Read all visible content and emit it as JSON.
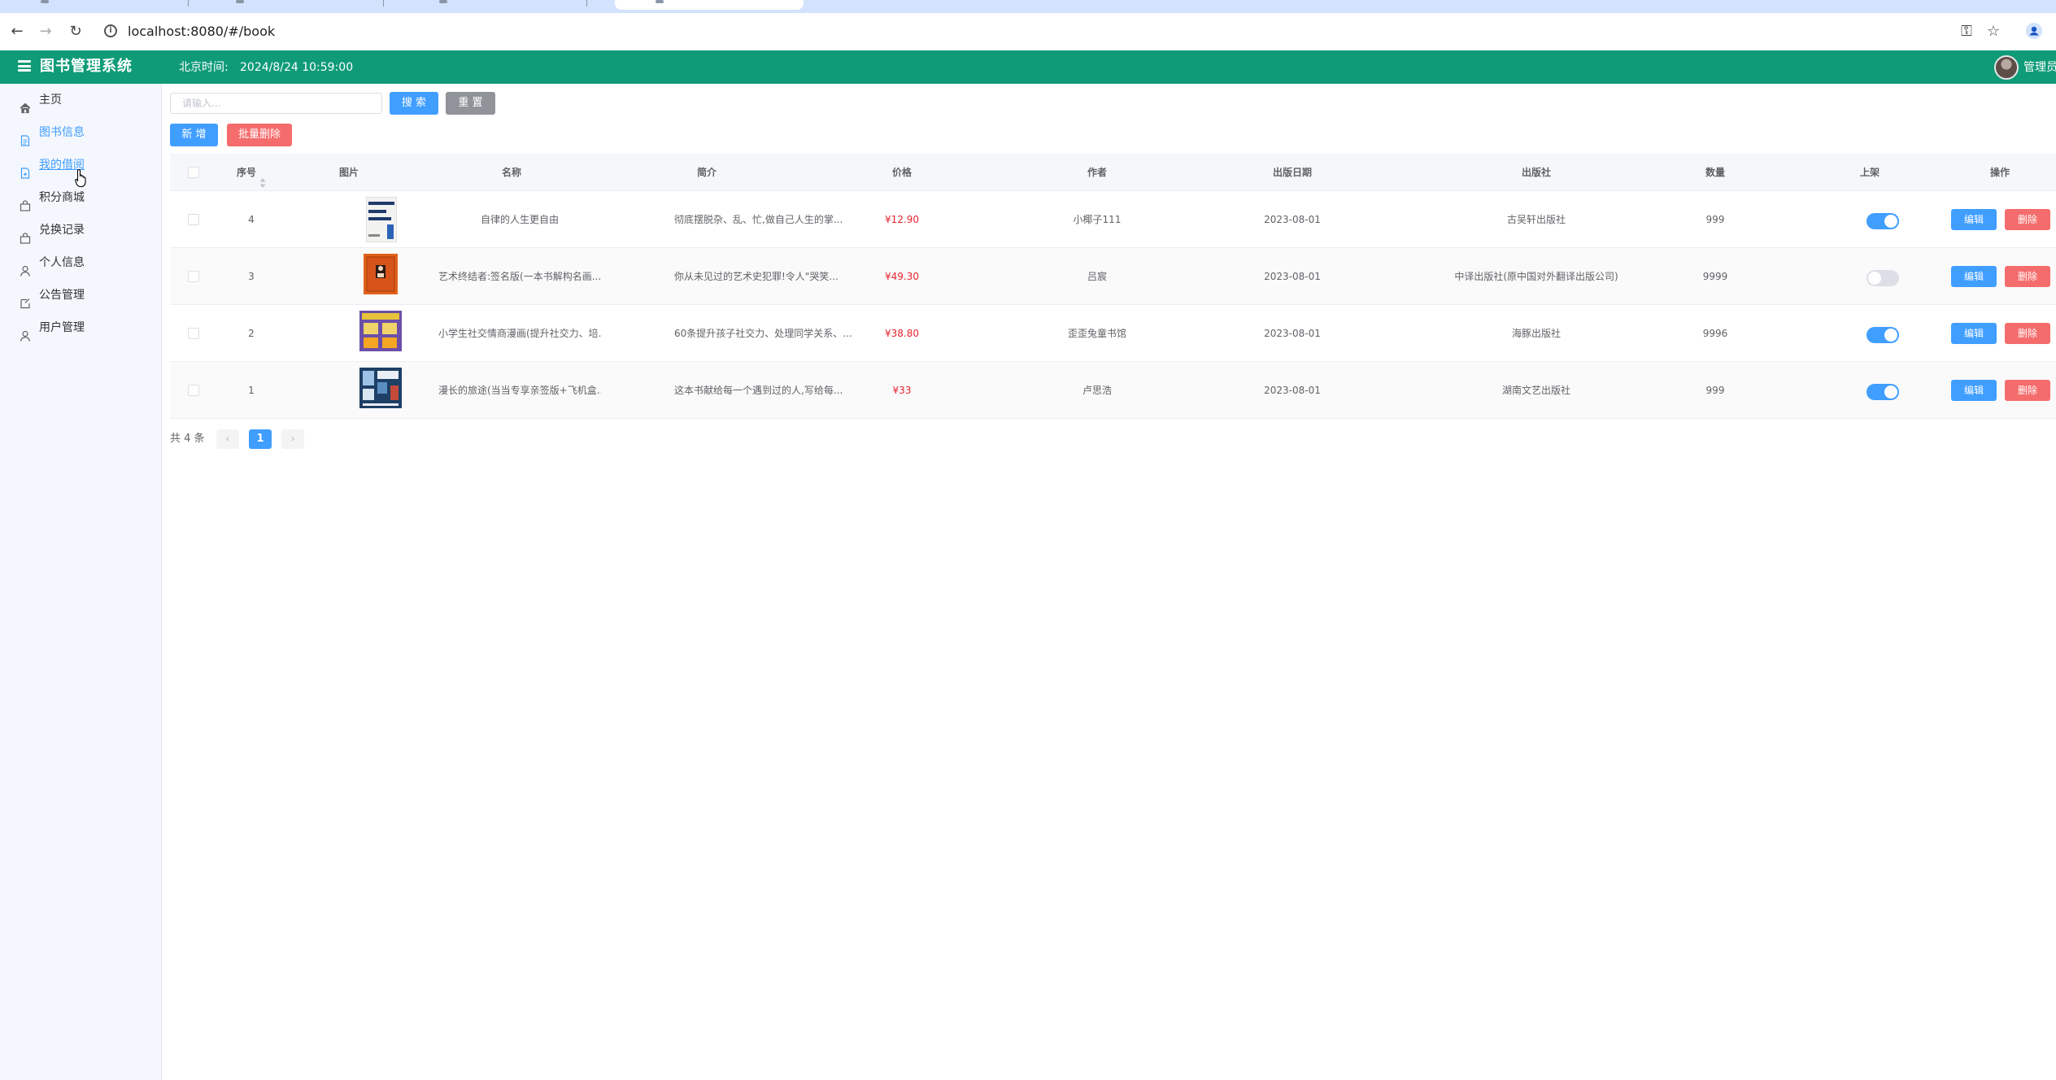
{
  "browser": {
    "url": "localhost:8080/#/book"
  },
  "header": {
    "title": "图书管理系统",
    "clock_label": "北京时间:",
    "clock_value": "2024/8/24 10:59:00",
    "user": "管理员"
  },
  "sidebar": {
    "items": [
      {
        "label": "主页",
        "icon": "home-icon"
      },
      {
        "label": "图书信息",
        "icon": "document-icon"
      },
      {
        "label": "我的借阅",
        "icon": "document-plus-icon"
      },
      {
        "label": "积分商城",
        "icon": "shopping-bag-icon"
      },
      {
        "label": "兑换记录",
        "icon": "shopping-bag-icon"
      },
      {
        "label": "个人信息",
        "icon": "user-icon"
      },
      {
        "label": "公告管理",
        "icon": "notice-icon"
      },
      {
        "label": "用户管理",
        "icon": "user-icon"
      }
    ]
  },
  "search": {
    "placeholder": "请输入...",
    "search_label": "搜 索",
    "reset_label": "重 置"
  },
  "actions": {
    "add_label": "新 增",
    "batch_delete_label": "批量删除"
  },
  "table": {
    "headers": {
      "id": "序号",
      "image": "图片",
      "name": "名称",
      "intro": "简介",
      "price": "价格",
      "author": "作者",
      "date": "出版日期",
      "publisher": "出版社",
      "quantity": "数量",
      "listed": "上架",
      "ops": "操作"
    },
    "edit_label": "编辑",
    "delete_label": "删除",
    "rows": [
      {
        "id": "4",
        "name": "自律的人生更自由",
        "intro": "彻底摆脱杂、乱、忙,做自己人生的掌...",
        "price": "¥12.90",
        "author": "小椰子111",
        "date": "2023-08-01",
        "publisher": "古吴轩出版社",
        "quantity": "999",
        "listed": true
      },
      {
        "id": "3",
        "name": "艺术终结者:签名版(一本书解构名画...",
        "intro": "你从未见过的艺术史犯罪!令人\"哭笑...",
        "price": "¥49.30",
        "author": "吕宸",
        "date": "2023-08-01",
        "publisher": "中译出版社(原中国对外翻译出版公司)",
        "quantity": "9999",
        "listed": false
      },
      {
        "id": "2",
        "name": "小学生社交情商漫画(提升社交力、培...",
        "intro": "60条提升孩子社交力、处理同学关系、...",
        "price": "¥38.80",
        "author": "歪歪兔童书馆",
        "date": "2023-08-01",
        "publisher": "海豚出版社",
        "quantity": "9996",
        "listed": true
      },
      {
        "id": "1",
        "name": "漫长的旅途(当当专享亲签版+飞机盒...",
        "intro": "这本书献给每一个遇到过的人,写给每...",
        "price": "¥33",
        "author": "卢思浩",
        "date": "2023-08-01",
        "publisher": "湖南文艺出版社",
        "quantity": "999",
        "listed": true
      }
    ]
  },
  "pagination": {
    "total": "共 4 条",
    "current": "1"
  },
  "colors": {
    "header": "#0f9b78",
    "primary": "#409eff",
    "danger": "#f56c6c",
    "info": "#909399",
    "price": "#e6242f",
    "sidebar_bg": "#f4f7fd"
  }
}
